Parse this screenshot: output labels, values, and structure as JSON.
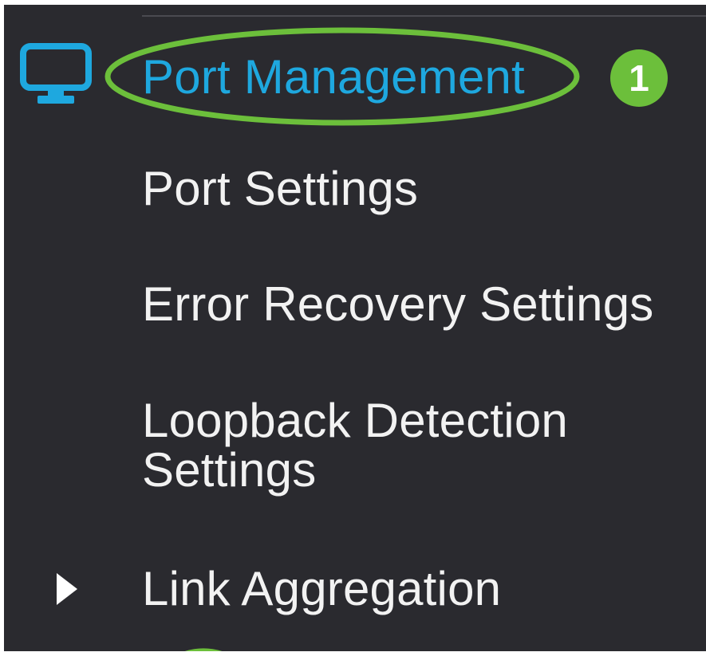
{
  "menu": {
    "section_title": "Port Management",
    "items": [
      {
        "label": "Port Settings"
      },
      {
        "label": "Error Recovery Settings"
      },
      {
        "label": "Loopback Detection Settings"
      },
      {
        "label": "Link Aggregation"
      }
    ]
  },
  "annotation": {
    "step_number": "1",
    "highlight_color": "#6cbf3b"
  },
  "icons": {
    "section_icon": "monitor-icon",
    "expand_icon": "caret-right-icon"
  },
  "colors": {
    "background": "#2a2a2f",
    "active_text": "#1ea8df",
    "text": "#f2f2f2"
  }
}
